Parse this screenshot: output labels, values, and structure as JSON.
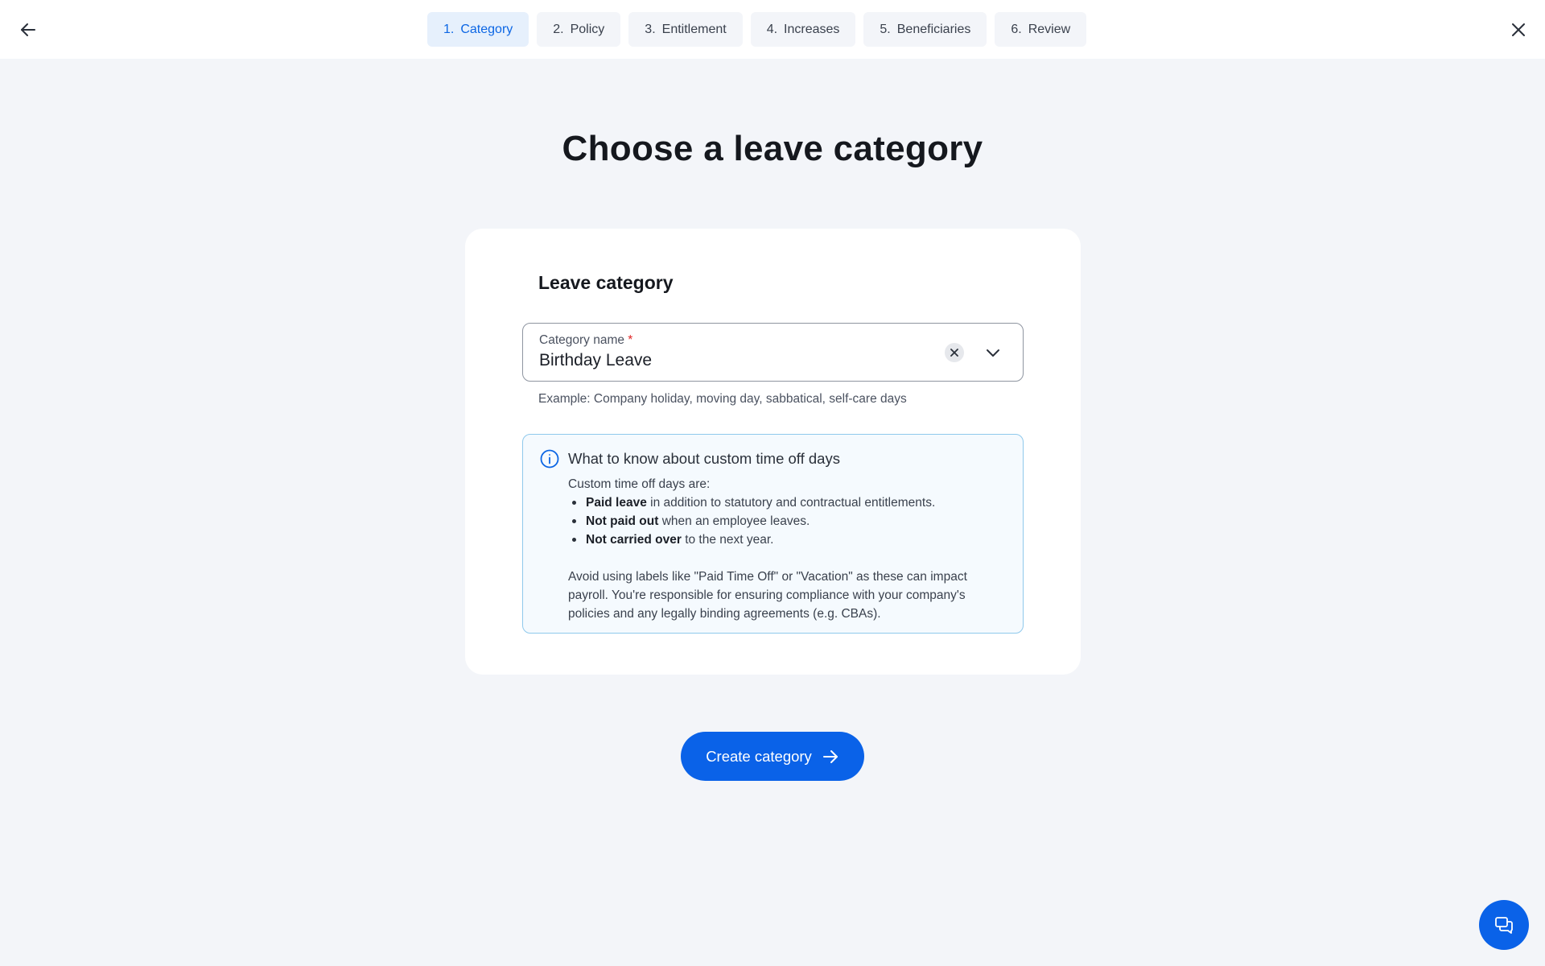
{
  "header": {
    "back_icon": "arrow-left-icon",
    "close_icon": "close-icon",
    "steps": [
      {
        "number": "1.",
        "label": "Category",
        "active": true
      },
      {
        "number": "2.",
        "label": "Policy",
        "active": false
      },
      {
        "number": "3.",
        "label": "Entitlement",
        "active": false
      },
      {
        "number": "4.",
        "label": "Increases",
        "active": false
      },
      {
        "number": "5.",
        "label": "Beneficiaries",
        "active": false
      },
      {
        "number": "6.",
        "label": "Review",
        "active": false
      }
    ]
  },
  "main": {
    "title": "Choose a leave category",
    "card": {
      "title": "Leave category",
      "field": {
        "label": "Category name",
        "required_marker": "*",
        "value": "Birthday Leave",
        "helper": "Example: Company holiday, moving day, sabbatical, self-care days"
      },
      "info": {
        "title": "What to know about custom time off days",
        "intro": "Custom time off days are:",
        "bullets": [
          {
            "bold": "Paid leave",
            "rest": " in addition to statutory and contractual entitlements."
          },
          {
            "bold": "Not paid out",
            "rest": " when an employee leaves."
          },
          {
            "bold": "Not carried over",
            "rest": " to the next year."
          }
        ],
        "note": "Avoid using labels like \"Paid Time Off\" or \"Vacation\" as these can impact payroll. You're responsible for ensuring compliance with your company's policies and any legally binding agreements (e.g. CBAs)."
      }
    },
    "cta_label": "Create category"
  },
  "colors": {
    "accent": "#0a62e8",
    "active_step_bg": "#e6f0fc",
    "page_bg": "#f3f5f9",
    "info_border": "#8fc9ec"
  }
}
